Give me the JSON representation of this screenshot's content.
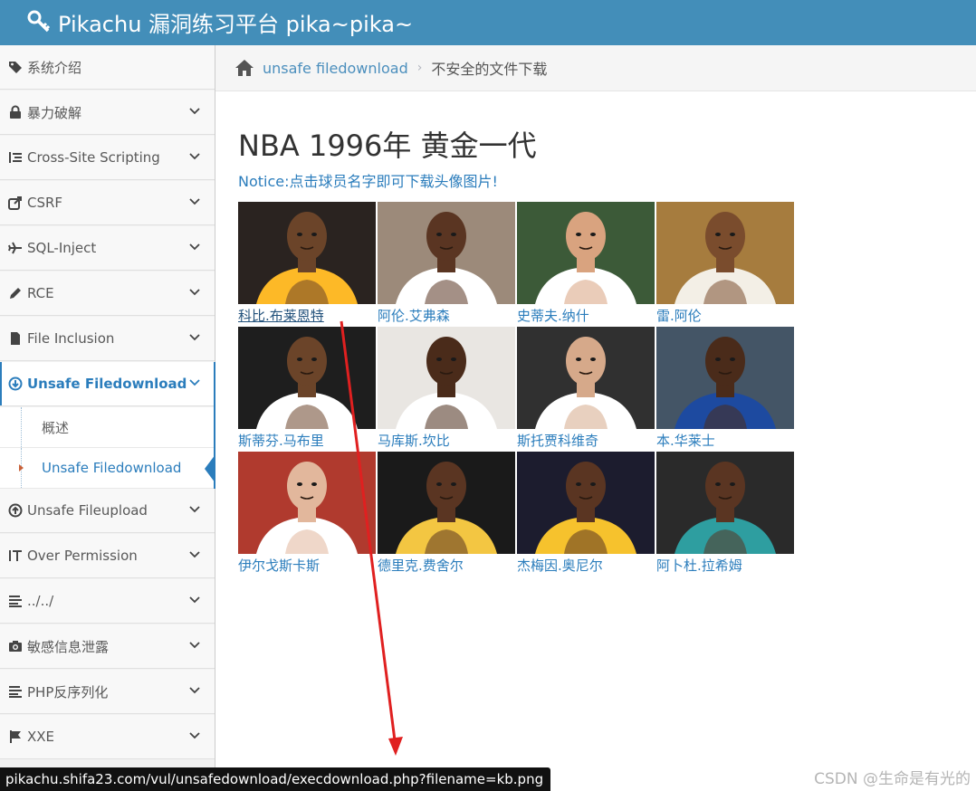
{
  "header": {
    "title": "Pikachu 漏洞练习平台 pika~pika~"
  },
  "sidebar": {
    "items": [
      {
        "label": "系统介绍",
        "icon": "tags-icon",
        "has_chevron": false
      },
      {
        "label": "暴力破解",
        "icon": "lock-icon",
        "has_chevron": true
      },
      {
        "label": "Cross-Site Scripting",
        "icon": "list-tree-icon",
        "has_chevron": true
      },
      {
        "label": "CSRF",
        "icon": "share-square-icon",
        "has_chevron": true
      },
      {
        "label": "SQL-Inject",
        "icon": "plane-icon",
        "has_chevron": true
      },
      {
        "label": "RCE",
        "icon": "pencil-icon",
        "has_chevron": true
      },
      {
        "label": "File Inclusion",
        "icon": "file-icon",
        "has_chevron": true
      },
      {
        "label": "Unsafe Filedownload",
        "icon": "download-circle-icon",
        "has_chevron": true,
        "active": true
      },
      {
        "label": "Unsafe Fileupload",
        "icon": "upload-circle-icon",
        "has_chevron": true
      },
      {
        "label": "Over Permission",
        "icon": "text-height-icon",
        "has_chevron": true
      },
      {
        "label": "../../",
        "icon": "align-left-icon",
        "has_chevron": true
      },
      {
        "label": "敏感信息泄露",
        "icon": "camera-icon",
        "has_chevron": true
      },
      {
        "label": "PHP反序列化",
        "icon": "align-left-icon",
        "has_chevron": true
      },
      {
        "label": "XXE",
        "icon": "flag-icon",
        "has_chevron": true
      }
    ],
    "subitems": [
      {
        "label": "概述"
      },
      {
        "label": "Unsafe Filedownload",
        "active": true
      }
    ]
  },
  "breadcrumb": {
    "link": "unsafe filedownload",
    "separator": "›",
    "current": "不安全的文件下载"
  },
  "main": {
    "title": "NBA 1996年 黄金一代",
    "notice": "Notice:点击球员名字即可下载头像图片!",
    "players": [
      {
        "name": "科比.布莱恩特",
        "jersey": "#fdb927",
        "skin": "#6b4429",
        "bg": "#2a2320"
      },
      {
        "name": "阿伦.艾弗森",
        "jersey": "#ffffff",
        "skin": "#5a3522",
        "bg": "#9c8a7a"
      },
      {
        "name": "史蒂夫.纳什",
        "jersey": "#ffffff",
        "skin": "#d9a37f",
        "bg": "#3c5a38"
      },
      {
        "name": "雷.阿伦",
        "jersey": "#f3efe6",
        "skin": "#7a4c2d",
        "bg": "#a67c3e"
      },
      {
        "name": "斯蒂芬.马布里",
        "jersey": "#ffffff",
        "skin": "#6b4429",
        "bg": "#1e1e1e"
      },
      {
        "name": "马库斯.坎比",
        "jersey": "#ffffff",
        "skin": "#4a2b1a",
        "bg": "#e9e6e2"
      },
      {
        "name": "斯托贾科维奇",
        "jersey": "#ffffff",
        "skin": "#d6a98a",
        "bg": "#303030"
      },
      {
        "name": "本.华莱士",
        "jersey": "#1d4aa0",
        "skin": "#4a2b1a",
        "bg": "#445566"
      },
      {
        "name": "伊尔戈斯卡斯",
        "jersey": "#ffffff",
        "skin": "#e2b79c",
        "bg": "#b03a2e"
      },
      {
        "name": "德里克.费舍尔",
        "jersey": "#f3c642",
        "skin": "#5a3522",
        "bg": "#1a1a1a"
      },
      {
        "name": "杰梅因.奥尼尔",
        "jersey": "#f6c22d",
        "skin": "#5a3522",
        "bg": "#1c1c2e"
      },
      {
        "name": "阿卜杜.拉希姆",
        "jersey": "#2e9ea0",
        "skin": "#5a3522",
        "bg": "#2a2a2a"
      }
    ]
  },
  "status": {
    "url": "pikachu.shifa23.com/vul/unsafedownload/execdownload.php?filename=kb.png"
  },
  "watermark": "CSDN @生命是有光的",
  "colors": {
    "header": "#438eb9",
    "accent": "#2b7dbc",
    "annotation_arrow": "#e02020"
  }
}
